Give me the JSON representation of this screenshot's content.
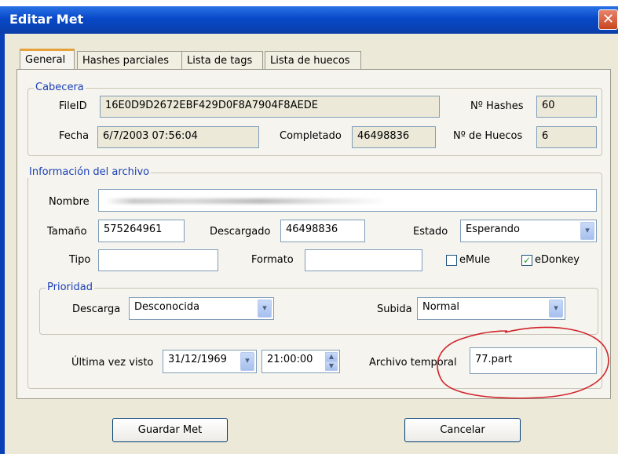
{
  "window": {
    "title": "Editar Met",
    "close_glyph": "✕"
  },
  "tabs": [
    {
      "label": "General"
    },
    {
      "label": "Hashes parciales"
    },
    {
      "label": "Lista de tags"
    },
    {
      "label": "Lista de huecos"
    }
  ],
  "cabecera": {
    "legend": "Cabecera",
    "fileid_label": "FileID",
    "fileid_value": "16E0D9D2672EBF429D0F8A7904F8AEDE",
    "nhashes_label": "Nº Hashes",
    "nhashes_value": "60",
    "fecha_label": "Fecha",
    "fecha_value": "6/7/2003 07:56:04",
    "completado_label": "Completado",
    "completado_value": "46498836",
    "nhuecos_label": "Nº de Huecos",
    "nhuecos_value": "6"
  },
  "archivo": {
    "legend": "Información del archivo",
    "nombre_label": "Nombre",
    "tamano_label": "Tamaño",
    "tamano_value": "575264961",
    "descargado_label": "Descargado",
    "descargado_value": "46498836",
    "estado_label": "Estado",
    "estado_value": "Esperando",
    "tipo_label": "Tipo",
    "tipo_value": "",
    "formato_label": "Formato",
    "formato_value": "",
    "emule_label": "eMule",
    "emule_checked": false,
    "edonkey_label": "eDonkey",
    "edonkey_checked": true
  },
  "prioridad": {
    "legend": "Prioridad",
    "descarga_label": "Descarga",
    "descarga_value": "Desconocida",
    "subida_label": "Subida",
    "subida_value": "Normal"
  },
  "ultima": {
    "label": "Última vez visto",
    "date_value": "31/12/1969",
    "time_value": "21:00:00",
    "temporal_label": "Archivo temporal",
    "temporal_value": "77.part"
  },
  "buttons": {
    "save": "Guardar Met",
    "cancel": "Cancelar"
  },
  "colors": {
    "annotation": "#d0242b",
    "title_bar": "#0848c8",
    "legend": "#1a3fb8"
  }
}
